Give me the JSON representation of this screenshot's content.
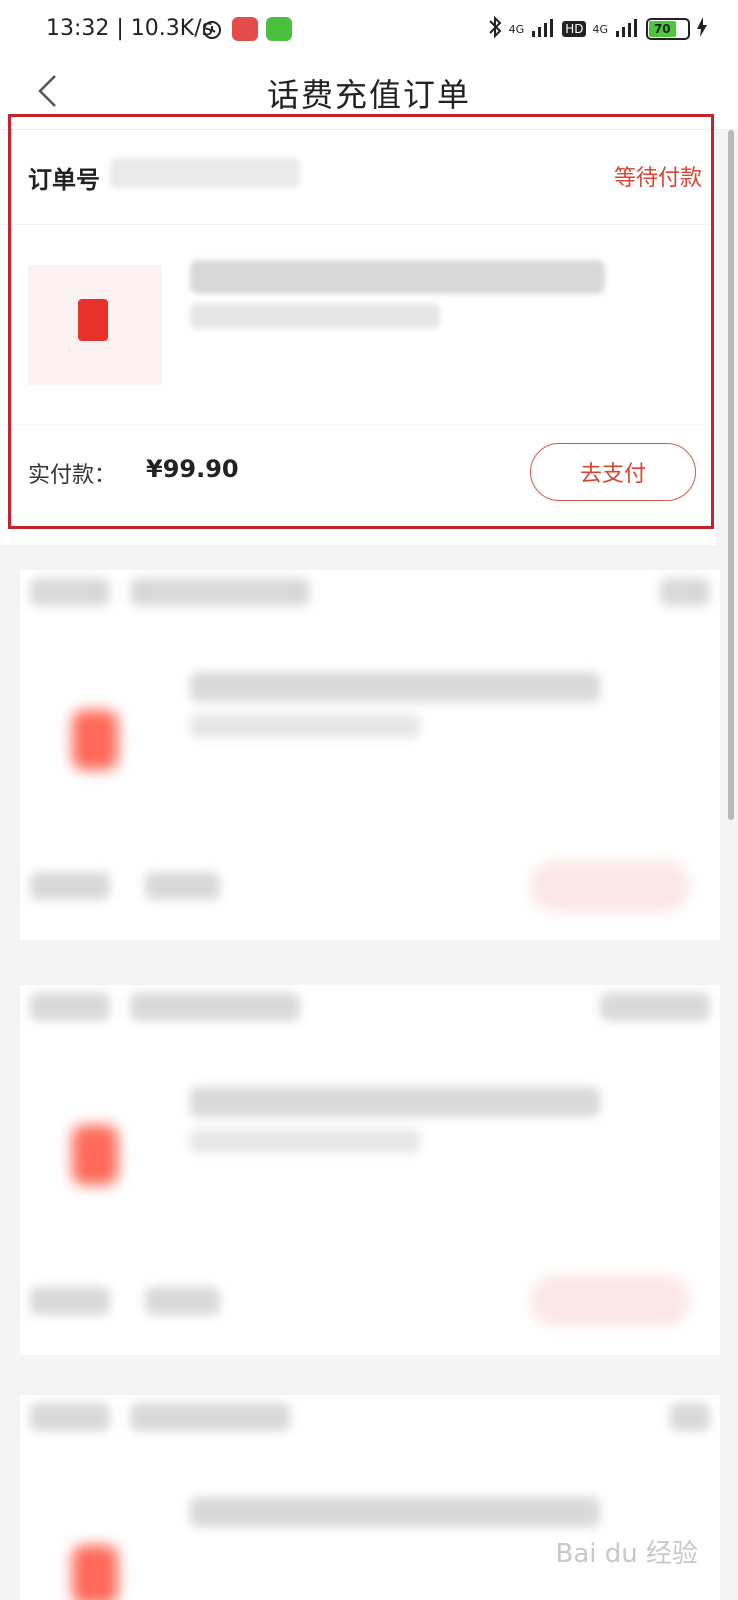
{
  "status_bar": {
    "time": "13:32 | 10.3K/s",
    "network_1": "4G",
    "network_2": "4G",
    "hd": "HD",
    "battery": "70"
  },
  "nav": {
    "title": "话费充值订单"
  },
  "order": {
    "order_no_label": "订单号",
    "status": "等待付款",
    "paid_label": "实付款：",
    "amount": "¥99.90",
    "pay_button": "去支付"
  },
  "icons": {
    "back": "chevron-left-icon",
    "alarm": "alarm-icon",
    "bluetooth": "bluetooth-icon",
    "charging": "charging-icon"
  },
  "colors": {
    "accent": "#d64532",
    "highlight_frame": "#c8232c"
  },
  "watermark": "Bai du 经验"
}
